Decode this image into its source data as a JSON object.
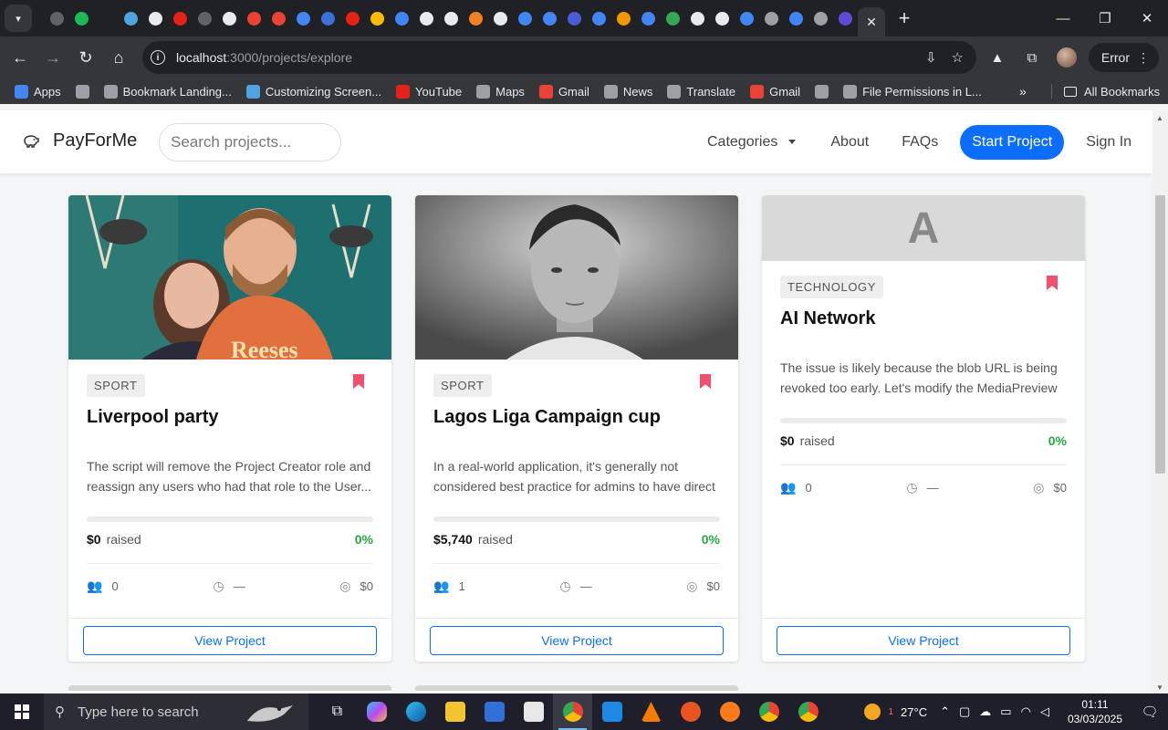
{
  "browser": {
    "url_host": "localhost",
    "url_path": ":3000/projects/explore",
    "error_label": "Error",
    "tab_colors": [
      "#5f6368",
      "#1db954",
      "#202124",
      "#4fa3e0",
      "#e8eaed",
      "#e62117",
      "#5f6368",
      "#e8eaed",
      "#ea4335",
      "#ea4335",
      "#4285f4",
      "#3c6fd8",
      "#e62117",
      "#fbbc04",
      "#4285f4",
      "#e8eaed",
      "#e8eaed",
      "#f48024",
      "#e8eaed",
      "#4285f4",
      "#4285f4",
      "#4a5bd4",
      "#4285f4",
      "#f29900",
      "#4285f4",
      "#34a853",
      "#e8eaed",
      "#e8eaed",
      "#4285f4",
      "#9aa0a6",
      "#4285f4",
      "#9aa0a6",
      "#5b4bd8"
    ]
  },
  "bookmarks": [
    {
      "label": "Apps",
      "color": "#4285f4"
    },
    {
      "label": "",
      "color": "#9aa0a6"
    },
    {
      "label": "Bookmark Landing...",
      "color": "#9aa0a6"
    },
    {
      "label": "Customizing Screen...",
      "color": "#4fa3e0"
    },
    {
      "label": "YouTube",
      "color": "#e62117"
    },
    {
      "label": "Maps",
      "color": "#9aa0a6"
    },
    {
      "label": "Gmail",
      "color": "#ea4335"
    },
    {
      "label": "News",
      "color": "#9aa0a6"
    },
    {
      "label": "Translate",
      "color": "#9aa0a6"
    },
    {
      "label": "Gmail",
      "color": "#ea4335"
    },
    {
      "label": "",
      "color": "#9aa0a6"
    },
    {
      "label": "File Permissions in L...",
      "color": "#9aa0a6"
    }
  ],
  "bookmarks_more": "»",
  "all_bookmarks": "All Bookmarks",
  "site": {
    "logo": "PayForMe",
    "search_placeholder": "Search projects...",
    "nav": {
      "categories": "Categories",
      "about": "About",
      "faqs": "FAQs",
      "start": "Start Project",
      "signin": "Sign In"
    }
  },
  "cards": [
    {
      "category": "SPORT",
      "title": "Liverpool party",
      "description": "The script will remove the Project Creator role and reassign any users who had that role to the User...",
      "raised": "$0",
      "raised_label": "raised",
      "percent": "0%",
      "progress": 0,
      "backers": "0",
      "time_left": "—",
      "goal": "$0",
      "button": "View Project"
    },
    {
      "category": "SPORT",
      "title": "Lagos Liga Campaign cup",
      "description": "In a real-world application, it's generally not considered best practice for admins to have direct",
      "raised": "$5,740",
      "raised_label": "raised",
      "percent": "0%",
      "progress": 0,
      "backers": "1",
      "time_left": "—",
      "goal": "$0",
      "button": "View Project"
    },
    {
      "placeholder_letter": "A",
      "category": "TECHNOLOGY",
      "title": "AI Network",
      "description": "The issue is likely because the blob URL is being revoked too early. Let's modify the MediaPreview",
      "raised": "$0",
      "raised_label": "raised",
      "percent": "0%",
      "progress": 0,
      "backers": "0",
      "time_left": "—",
      "goal": "$0",
      "button": "View Project"
    }
  ],
  "taskbar": {
    "search_placeholder": "Type here to search",
    "weather_badge": "1",
    "temperature": "27°C",
    "time": "01:11",
    "date": "03/03/2025"
  }
}
